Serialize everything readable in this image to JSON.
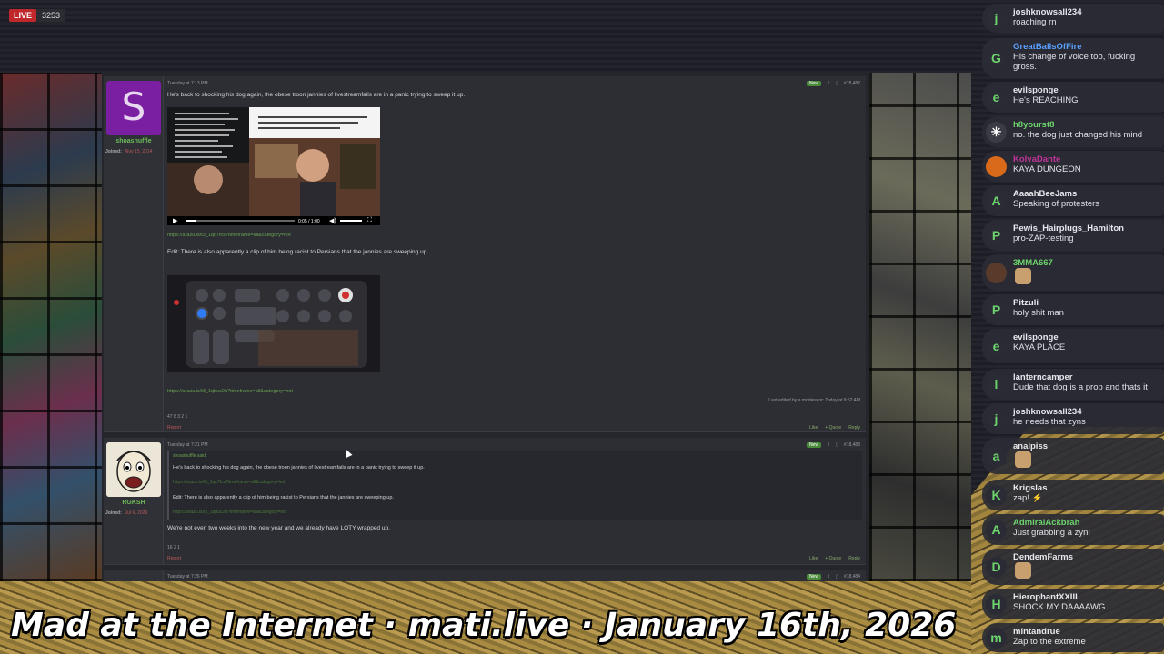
{
  "stream": {
    "live_label": "LIVE",
    "viewer_count": "3253"
  },
  "banner": "Mad at the Internet · mati.live · January 16th, 2026",
  "forum": {
    "post1": {
      "date": "Tuesday at 7:13 PM",
      "number": "#18,482",
      "new_label": "New",
      "username": "shoashuffle",
      "avatar_letter": "S",
      "joined_label": "Joined:",
      "joined_date": "Nov 15, 2014",
      "text": "He's back to shocking his dog again, the obese troon jannies of livestreamfails are in a panic trying to sweep it up.",
      "video_time": "0:05 / 1:00",
      "link1": "https://arazu.is/t3_1qc7fcs?timeframe=all&category=hot",
      "edit_text": "Edit: There is also apparently a clip of him being racist to Persians that the jannies are sweeping up.",
      "link2": "https://arazu.is/t3_1qbuc2u?timeframe=all&category=hot",
      "edited_note": "Last edited by a moderator: Today at 9:52 AM",
      "reactions": "47  8  3  2  1",
      "report": "Report",
      "like": "Like",
      "quote": "+ Quote",
      "reply": "Reply"
    },
    "post2": {
      "date": "Tuesday at 7:21 PM",
      "number": "#18,483",
      "new_label": "New",
      "username": "RGKSH",
      "joined_label": "Joined:",
      "joined_date": "Jul 6, 2026",
      "quote_author": "shoashuffle said:",
      "quote_text": "He's back to shocking his dog again, the obese troon jannies of livestreamfails are in a panic trying to sweep it up.",
      "quote_link1": "https://arazu.is/t3_1qc7fcs?timeframe=all&category=hot",
      "quote_edit": "Edit: There is also apparently a clip of him being racist to Persians that the jannies are sweeping up.",
      "quote_link2": "https://arazu.is/t3_1qbuc2u?timeframe=all&category=hot",
      "text": "We're not even two weeks into the new year and we already have LOTY wrapped up.",
      "reactions": "16  2  1",
      "report": "Report",
      "like": "Like",
      "quote": "+ Quote",
      "reply": "Reply"
    },
    "post3": {
      "date": "Tuesday at 7:26 PM",
      "number": "#18,484",
      "new_label": "New"
    }
  },
  "chat": [
    {
      "user": "joshknowsall234",
      "text": "roaching rn",
      "initial": "j",
      "color": "#e8e8ee",
      "av_bg": "#2a2b34"
    },
    {
      "user": "GreatBallsOfFire",
      "text": "His change of voice too, fucking",
      "text2": "gross.",
      "initial": "G",
      "color": "#5aa0ff",
      "av_bg": "#2a2b34"
    },
    {
      "user": "evilsponge",
      "text": "He's REACHING",
      "initial": "e",
      "color": "#e8e8ee",
      "av_bg": "#2a2b34"
    },
    {
      "user": "h8yourst8",
      "text": "no. the dog just changed his mind",
      "initial": "✳",
      "color": "#6dd36d",
      "av_bg": "#3a3b44"
    },
    {
      "user": "KolyaDante",
      "text": "KAYA DUNGEON",
      "initial": "",
      "color": "#c0359a",
      "av_bg": "#d86a1a"
    },
    {
      "user": "AaaahBeeJams",
      "text": "Speaking of protesters",
      "initial": "A",
      "color": "#e8e8ee",
      "av_bg": "#2a2b34"
    },
    {
      "user": "Pewis_Hairplugs_Hamilton",
      "text": "pro-ZAP-testing",
      "initial": "P",
      "color": "#e8e8ee",
      "av_bg": "#2a2b34"
    },
    {
      "user": "3MMA667",
      "text": "",
      "initial": "",
      "color": "#6dd36d",
      "av_bg": "#5a3a2a"
    },
    {
      "user": "Pitzuli",
      "text": "holy shit man",
      "initial": "P",
      "color": "#e8e8ee",
      "av_bg": "#2a2b34"
    },
    {
      "user": "evilsponge",
      "text": "KAYA PLACE",
      "initial": "e",
      "color": "#e8e8ee",
      "av_bg": "#2a2b34"
    },
    {
      "user": "lanterncamper",
      "text": "Dude that dog is a prop and thats it",
      "initial": "l",
      "color": "#e8e8ee",
      "av_bg": "#2a2b34"
    },
    {
      "user": "joshknowsall234",
      "text": "he needs that zyns",
      "initial": "j",
      "color": "#e8e8ee",
      "av_bg": "#2a2b34"
    },
    {
      "user": "analpiss",
      "text": "",
      "initial": "a",
      "color": "#e8e8ee",
      "av_bg": "#2a2b34"
    },
    {
      "user": "Krigslas",
      "text": "zap! ⚡",
      "initial": "K",
      "color": "#e8e8ee",
      "av_bg": "#2a2b34"
    },
    {
      "user": "AdmiralAckbrah",
      "text": "Just grabbing a zyn!",
      "initial": "A",
      "color": "#6dd36d",
      "av_bg": "#2a2b34"
    },
    {
      "user": "DendemFarms",
      "text": "",
      "initial": "D",
      "color": "#e8e8ee",
      "av_bg": "#2a2b34"
    },
    {
      "user": "HierophantXXIII",
      "text": "SHOCK MY DAAAAWG",
      "initial": "H",
      "color": "#e8e8ee",
      "av_bg": "#2a2b34"
    },
    {
      "user": "mintandrue",
      "text": "Zap to the extreme",
      "initial": "m",
      "color": "#e8e8ee",
      "av_bg": "#2a2b34"
    }
  ]
}
